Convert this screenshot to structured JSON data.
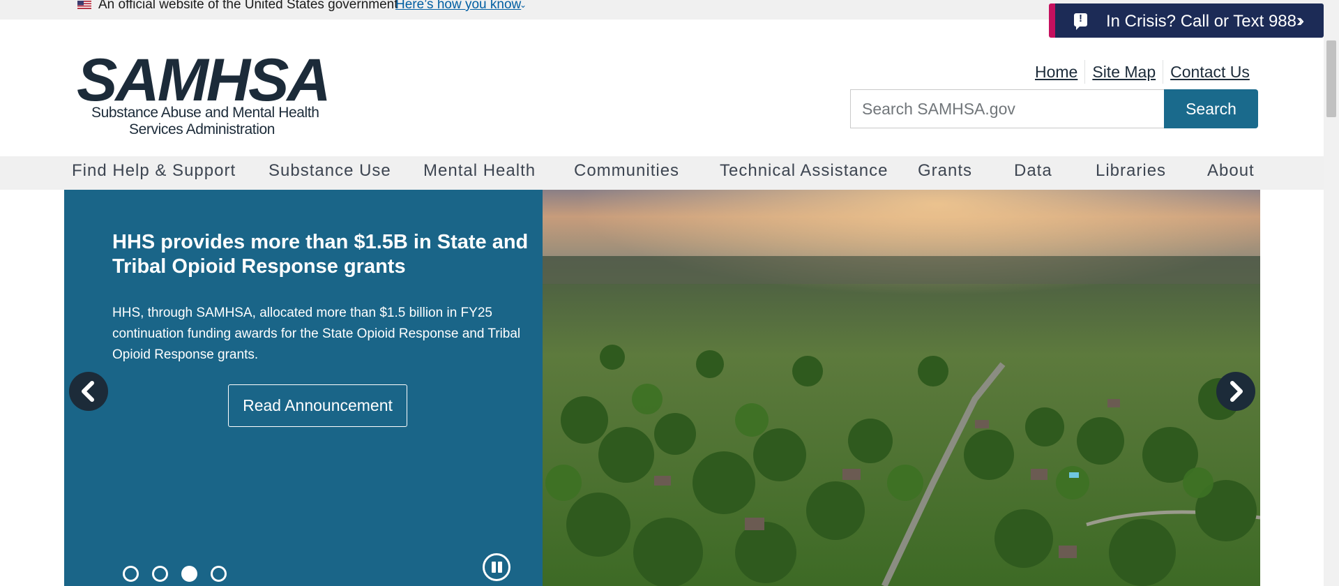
{
  "gov_banner": {
    "flag_icon": "us-flag-icon",
    "text": "An official website of the United States government",
    "link": "Here’s how you know",
    "chevron_icon": "chevron-down-icon"
  },
  "crisis": {
    "label": "In Crisis? Call or Text 988",
    "icon": "alert-bubble-icon",
    "chevron_icon": "double-chevron-right-icon",
    "colors": {
      "background": "#1c2b56",
      "accent": "#c5105e"
    }
  },
  "logo": {
    "wordmark": "SAMHSA",
    "line1": "Substance Abuse and Mental Health",
    "line2": "Services Administration"
  },
  "utility_links": [
    "Home",
    "Site Map",
    "Contact Us"
  ],
  "search": {
    "placeholder": "Search SAMHSA.gov",
    "value": "",
    "button_label": "Search"
  },
  "nav": {
    "items": [
      "Find Help & Support",
      "Substance Use",
      "Mental Health",
      "Communities",
      "Technical Assistance",
      "Grants",
      "Data",
      "Libraries",
      "About"
    ]
  },
  "hero": {
    "title": "HHS provides more than $1.5B in State and Tribal Opioid Response grants",
    "body": "HHS, through SAMHSA, allocated more than $1.5 billion in FY25 continuation funding awards for the State Opioid Response and Tribal Opioid Response grants.",
    "cta_label": "Read Announcement",
    "image_description_icon": "aerial-neighborhood-photo",
    "slides_total": 4,
    "active_slide": 3,
    "prev_icon": "chevron-left-icon",
    "next_icon": "chevron-right-icon",
    "pause_icon": "pause-icon",
    "colors": {
      "panel": "#1a6588",
      "primary": "#1a6a8c"
    }
  }
}
